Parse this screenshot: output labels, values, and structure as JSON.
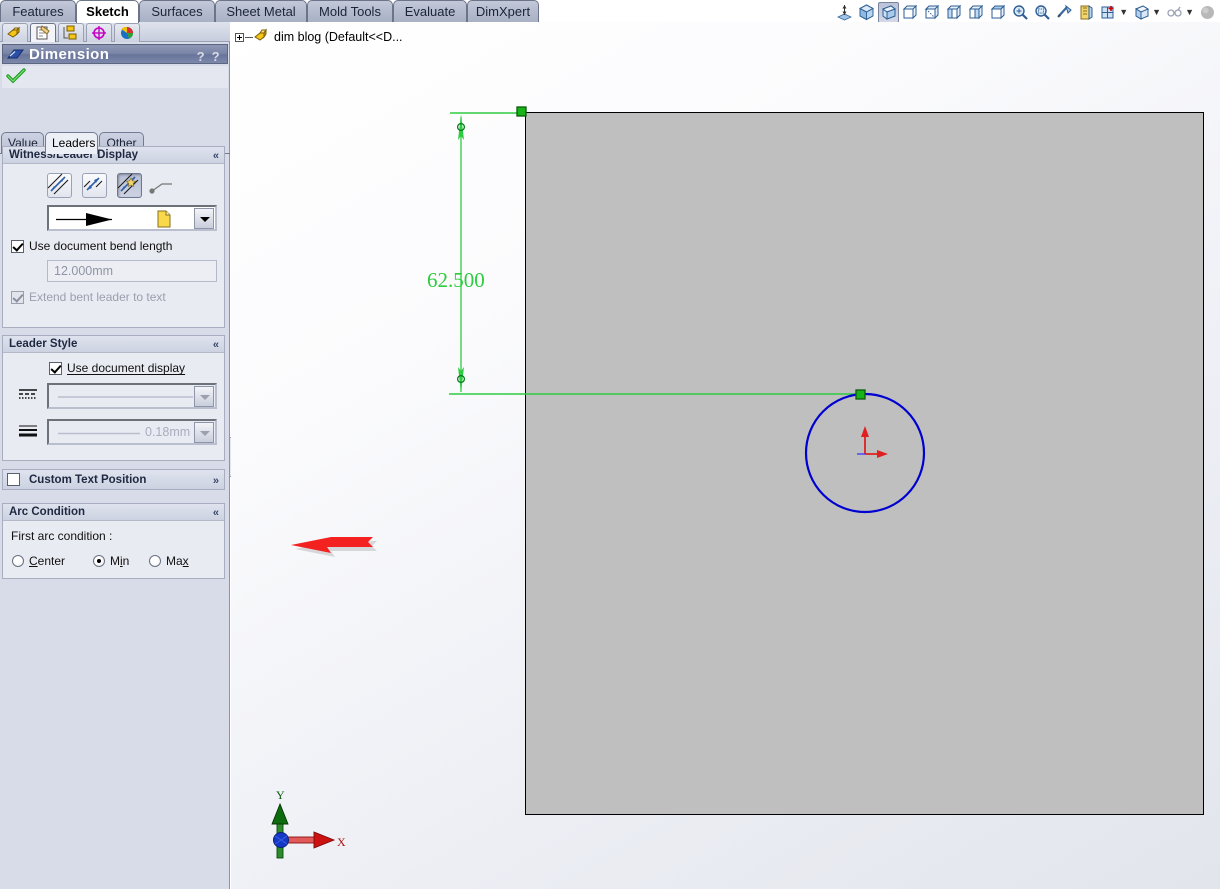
{
  "command_tabs": [
    {
      "label": "Features",
      "active": false
    },
    {
      "label": "Sketch",
      "active": true
    },
    {
      "label": "Surfaces",
      "active": false
    },
    {
      "label": "Sheet Metal",
      "active": false
    },
    {
      "label": "Mold Tools",
      "active": false
    },
    {
      "label": "Evaluate",
      "active": false
    },
    {
      "label": "DimXpert",
      "active": false
    }
  ],
  "manager_tabs": [
    {
      "name": "feature-manager-design-tree",
      "selected": false
    },
    {
      "name": "property-manager",
      "selected": true
    },
    {
      "name": "configuration-manager",
      "selected": false
    },
    {
      "name": "dimxpert-manager",
      "selected": false
    },
    {
      "name": "display-manager",
      "selected": false
    }
  ],
  "property_manager": {
    "title": "Dimension",
    "title_icon": "dimension-icon",
    "help_icons": [
      "whats-this-help-icon",
      "help-icon"
    ],
    "ok_icon": "green-check-ok-icon",
    "tabs": [
      {
        "label": "Value",
        "active": false
      },
      {
        "label": "Leaders",
        "active": true
      },
      {
        "label": "Other",
        "active": false
      }
    ],
    "groups": [
      {
        "title": "Witness/Leader Display",
        "collapse_glyph": "«",
        "buttons": [
          {
            "name": "outside-witness-lines-button",
            "pressed": false
          },
          {
            "name": "inside-witness-lines-button",
            "pressed": false
          },
          {
            "name": "smart-witness-lines-button",
            "pressed": true
          }
        ],
        "extra_icon": "bent-leader-icon",
        "arrow_style_combo": {
          "name": "arrow-style-combo",
          "value_icon": "solid-arrowhead",
          "doc_icon": "use-document-style-icon"
        },
        "checkbox1": {
          "label": "Use document bend length",
          "checked": true,
          "disabled": false
        },
        "bend_length_value": "12.000mm",
        "checkbox2": {
          "label": "Extend bent leader to text",
          "checked": true,
          "disabled": true
        }
      },
      {
        "title": "Leader Style",
        "collapse_glyph": "«",
        "checkbox": {
          "label": "Use document display",
          "checked": true,
          "disabled": false
        },
        "line_style_combo": {
          "name": "leader-line-style-combo",
          "icon": "line-style-icon",
          "value": "",
          "disabled": true
        },
        "line_thickness_combo": {
          "name": "leader-line-thickness-combo",
          "icon": "line-thickness-icon",
          "value": "0.18mm",
          "disabled": true
        }
      },
      {
        "title": "Custom Text Position",
        "collapse_glyph": "»",
        "checked": false
      },
      {
        "title": "Arc Condition",
        "collapse_glyph": "«",
        "caption": "First arc condition :",
        "radios": [
          {
            "label": "Center",
            "selected": false,
            "mnemonic_index": 0
          },
          {
            "label": "Min",
            "selected": true,
            "mnemonic_index": 2
          },
          {
            "label": "Max",
            "selected": false,
            "mnemonic_index": 2
          }
        ]
      }
    ]
  },
  "feature_tree": {
    "expander": "plus",
    "icon": "part-document-icon",
    "label": "dim blog  (Default<<D..."
  },
  "view_toolbar": [
    {
      "name": "section-view-icon",
      "active": false,
      "has_dropdown": false
    },
    {
      "name": "view-orientation-isometric-icon",
      "active": false,
      "has_dropdown": false
    },
    {
      "name": "view-orientation-trimetric-icon",
      "active": true,
      "has_dropdown": false
    },
    {
      "name": "view-orientation-front-icon",
      "active": false,
      "has_dropdown": false
    },
    {
      "name": "view-orientation-back-icon",
      "active": false,
      "has_dropdown": false
    },
    {
      "name": "view-orientation-left-icon",
      "active": false,
      "has_dropdown": false
    },
    {
      "name": "view-orientation-right-icon",
      "active": false,
      "has_dropdown": false
    },
    {
      "name": "view-orientation-top-icon",
      "active": false,
      "has_dropdown": false
    },
    {
      "name": "zoom-to-fit-icon",
      "active": false,
      "has_dropdown": false
    },
    {
      "name": "zoom-to-area-icon",
      "active": false,
      "has_dropdown": false
    },
    {
      "name": "measure-icon",
      "active": false,
      "has_dropdown": false
    },
    {
      "name": "section-properties-icon",
      "active": false,
      "has_dropdown": false
    },
    {
      "name": "apply-scene-icon",
      "active": false,
      "has_dropdown": true
    },
    {
      "name": "display-style-icon",
      "active": false,
      "has_dropdown": true
    },
    {
      "name": "hide-show-items-icon",
      "active": false,
      "has_dropdown": true
    },
    {
      "name": "options-sphere-icon",
      "active": false,
      "has_dropdown": false
    }
  ],
  "graphics": {
    "dimension_value": "62.500",
    "dimension_color": "#2ecc40",
    "model_face_color": "#bfbfbf",
    "circle_color": "#0000d0",
    "selected_point_color": "#00b000",
    "annotation_arrow_color": "#f42121",
    "triad": {
      "x_label": "X",
      "y_label": "Y",
      "x_color": "#d40000",
      "y_color": "#006400",
      "origin_color": "#1438c8"
    }
  }
}
